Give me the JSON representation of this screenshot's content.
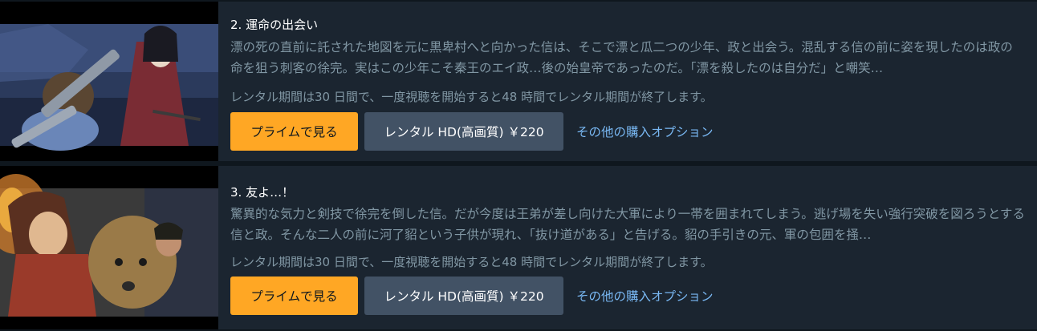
{
  "episodes": [
    {
      "title": "2. 運命の出会い",
      "synopsis": "漂の死の直前に託された地図を元に黒卑村へと向かった信は、そこで漂と瓜二つの少年、政と出会う。混乱する信の前に姿を現したのは政の命を狙う刺客の徐完。実はこの少年こそ秦王のエイ政…後の始皇帝であったのだ。「漂を殺したのは自分だ」と嘲笑…",
      "rental_note": "レンタル期間は30 日間で、一度視聴を開始すると48 時間でレンタル期間が終了します。",
      "prime_button": "プライムで見る",
      "rent_button": "レンタル HD(高画質) ￥220",
      "more_options": "その他の購入オプション"
    },
    {
      "title": "3. 友よ…！",
      "synopsis": "驚異的な気力と剣技で徐完を倒した信。だが今度は王弟が差し向けた大軍により一帯を囲まれてしまう。逃げ場を失い強行突破を図ろうとする信と政。そんな二人の前に河了貂という子供が現れ、「抜け道がある」と告げる。貂の手引きの元、軍の包囲を掻…",
      "rental_note": "レンタル期間は30 日間で、一度視聴を開始すると48 時間でレンタル期間が終了します。",
      "prime_button": "プライムで見る",
      "rent_button": "レンタル HD(高画質) ￥220",
      "more_options": "その他の購入オプション"
    }
  ],
  "colors": {
    "page_bg": "#0f171e",
    "card_bg": "#1b2530",
    "prime_button": "#ffa724",
    "rent_button": "#425265",
    "link": "#79b8f3",
    "muted_text": "#8197a4"
  }
}
